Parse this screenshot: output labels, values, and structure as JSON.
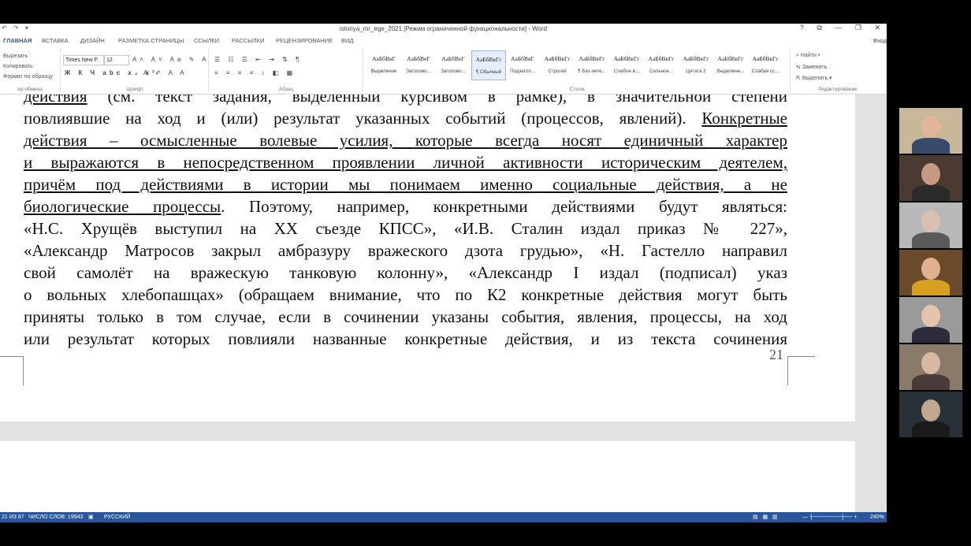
{
  "window": {
    "title": "istoriya_mr_ege_2021 [Режим ограниченной функциональности] - Word",
    "help": "?",
    "controls": [
      "⧉",
      "—",
      "❐",
      "✕"
    ]
  },
  "tabs": [
    "ГЛАВНАЯ",
    "ВСТАВКА",
    "ДИЗАЙН",
    "РАЗМЕТКА СТРАНИЦЫ",
    "ССЫЛКИ",
    "РАССЫЛКИ",
    "РЕЦЕНЗИРОВАНИЕ",
    "ВИД"
  ],
  "signin": "Вход",
  "ribbon": {
    "clipboard": {
      "cut": "Вырезать",
      "copy": "Копировать",
      "format_painter": "Формат по образцу",
      "label": "ер обмена"
    },
    "font": {
      "name": "Times New F",
      "size": "12",
      "label": "Шрифт"
    },
    "paragraph": {
      "label": "Абзац"
    },
    "styles": {
      "items": [
        {
          "sample": "АаБбВвГ",
          "name": "Выделение"
        },
        {
          "sample": "АаБбВеГ",
          "name": "Заголово..."
        },
        {
          "sample": "АаБбВеГ",
          "name": "Заголово..."
        },
        {
          "sample": "АаБбВвГг",
          "name": "¶ Обычный"
        },
        {
          "sample": "АаБбВвГ",
          "name": "Подзагол..."
        },
        {
          "sample": "АаБбВвГг",
          "name": "Строгий"
        },
        {
          "sample": "АаБбВвГг",
          "name": "¶ Без инте..."
        },
        {
          "sample": "АаБбВвГг",
          "name": "Слабое в..."
        },
        {
          "sample": "АаБбВвГг",
          "name": "Сильное..."
        },
        {
          "sample": "АаБбВвГг",
          "name": "Цитата 2"
        },
        {
          "sample": "АаБбВвГг",
          "name": "Выделенн..."
        },
        {
          "sample": "АаБбВвГг",
          "name": "Слабая сс..."
        }
      ],
      "label": "Стили"
    },
    "editing": {
      "find": "Найти",
      "replace": "Заменить",
      "select": "Выделить",
      "label": "Редактирование"
    }
  },
  "document": {
    "lines": [
      {
        "parts": [
          {
            "t": "действия",
            "u": true
          },
          {
            "t": " (см. текст задания, выделенный курсивом в рамке), в значительной степени",
            "u": false
          }
        ]
      },
      {
        "parts": [
          {
            "t": "повлиявшие на ход и (или) результат указанных событий (процессов, явлений). ",
            "u": false
          },
          {
            "t": "Конкретные",
            "u": true
          }
        ]
      },
      {
        "parts": [
          {
            "t": "действия – осмысленные волевые усилия, которые всегда носят единичный характер",
            "u": true
          }
        ]
      },
      {
        "parts": [
          {
            "t": "и выражаются в непосредственном проявлении личной активности историческим деятелем,",
            "u": true
          }
        ]
      },
      {
        "parts": [
          {
            "t": "причём под действиями в истории мы понимаем именно социальные действия, а не",
            "u": true
          }
        ]
      },
      {
        "parts": [
          {
            "t": "биологические процессы",
            "u": true
          },
          {
            "t": ". Поэтому, например, конкретными действиями будут являться:",
            "u": false
          }
        ]
      },
      {
        "parts": [
          {
            "t": "«Н.С. Хрущёв выступил на XX съезде КПСС», «И.В. Сталин издал приказ № 227»,",
            "u": false
          }
        ]
      },
      {
        "parts": [
          {
            "t": "«Александр Матросов закрыл амбразуру вражеского дзота грудью», «Н. Гастелло направил",
            "u": false
          }
        ]
      },
      {
        "parts": [
          {
            "t": "свой самолёт на вражескую танковую колонну», «Александр I издал (подписал) указ",
            "u": false
          }
        ]
      },
      {
        "parts": [
          {
            "t": "о вольных хлебопашцах» (обращаем внимание, что по К2 конкретные действия могут быть",
            "u": false
          }
        ]
      },
      {
        "parts": [
          {
            "t": "приняты только в том случае, если в сочинении указаны события, явления, процессы, на ход",
            "u": false
          }
        ]
      },
      {
        "parts": [
          {
            "t": "или результат которых повлияли названные конкретные действия, и из текста сочинения",
            "u": false
          }
        ]
      }
    ],
    "page_number": "21"
  },
  "status": {
    "page": "21 ИЗ 87",
    "words": "ЧИСЛО СЛОВ: 19943",
    "language": "РУССКИЙ",
    "zoom": "240%"
  },
  "participants": 7
}
